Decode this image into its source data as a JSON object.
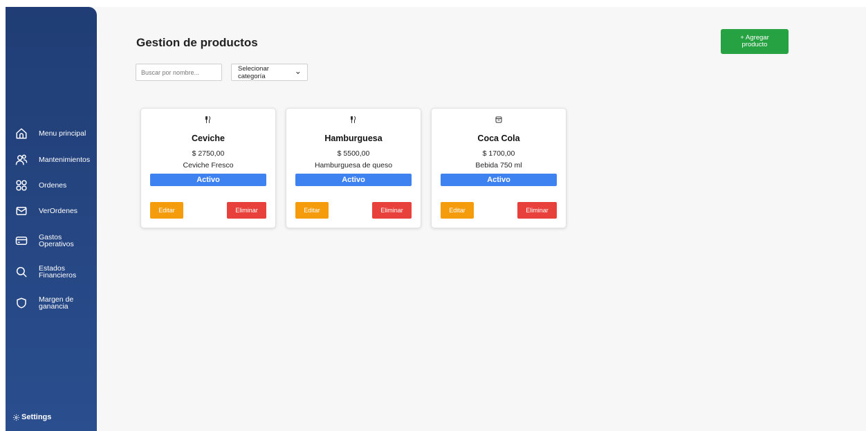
{
  "sidebar": {
    "items": [
      {
        "label": "Menu principal",
        "icon": "home-icon"
      },
      {
        "label": "Mantenimientos",
        "icon": "users-icon"
      },
      {
        "label": "Ordenes",
        "icon": "grid-icon"
      },
      {
        "label": "VerOrdenes",
        "icon": "mail-icon"
      },
      {
        "label": "Gastos Operativos",
        "icon": "credit-card-icon"
      },
      {
        "label": "Estados Financieros",
        "icon": "search-icon"
      },
      {
        "label": "Margen de ganancia",
        "icon": "shield-icon"
      }
    ],
    "settings_label": "Settings"
  },
  "header": {
    "title": "Gestion de productos",
    "add_button_label": "+ Agregar producto"
  },
  "filters": {
    "search_placeholder": "Buscar por nombre...",
    "category_selected": "Selecionar categoría"
  },
  "products": [
    {
      "name": "Ceviche",
      "price": "$ 2750,00",
      "description": "Ceviche Fresco",
      "status": "Activo",
      "icon": "utensils-icon"
    },
    {
      "name": "Hamburguesa",
      "price": "$ 5500,00",
      "description": "Hamburguesa de queso",
      "status": "Activo",
      "icon": "utensils-icon"
    },
    {
      "name": "Coca Cola",
      "price": "$ 1700,00",
      "description": "Bebida 750 ml",
      "status": "Activo",
      "icon": "archive-icon"
    }
  ],
  "actions": {
    "edit_label": "Editar",
    "delete_label": "Eliminar"
  },
  "colors": {
    "sidebar": "#24437f",
    "add_button": "#27a243",
    "status": "#3e82f2",
    "edit": "#f59c0d",
    "delete": "#e8403a"
  }
}
